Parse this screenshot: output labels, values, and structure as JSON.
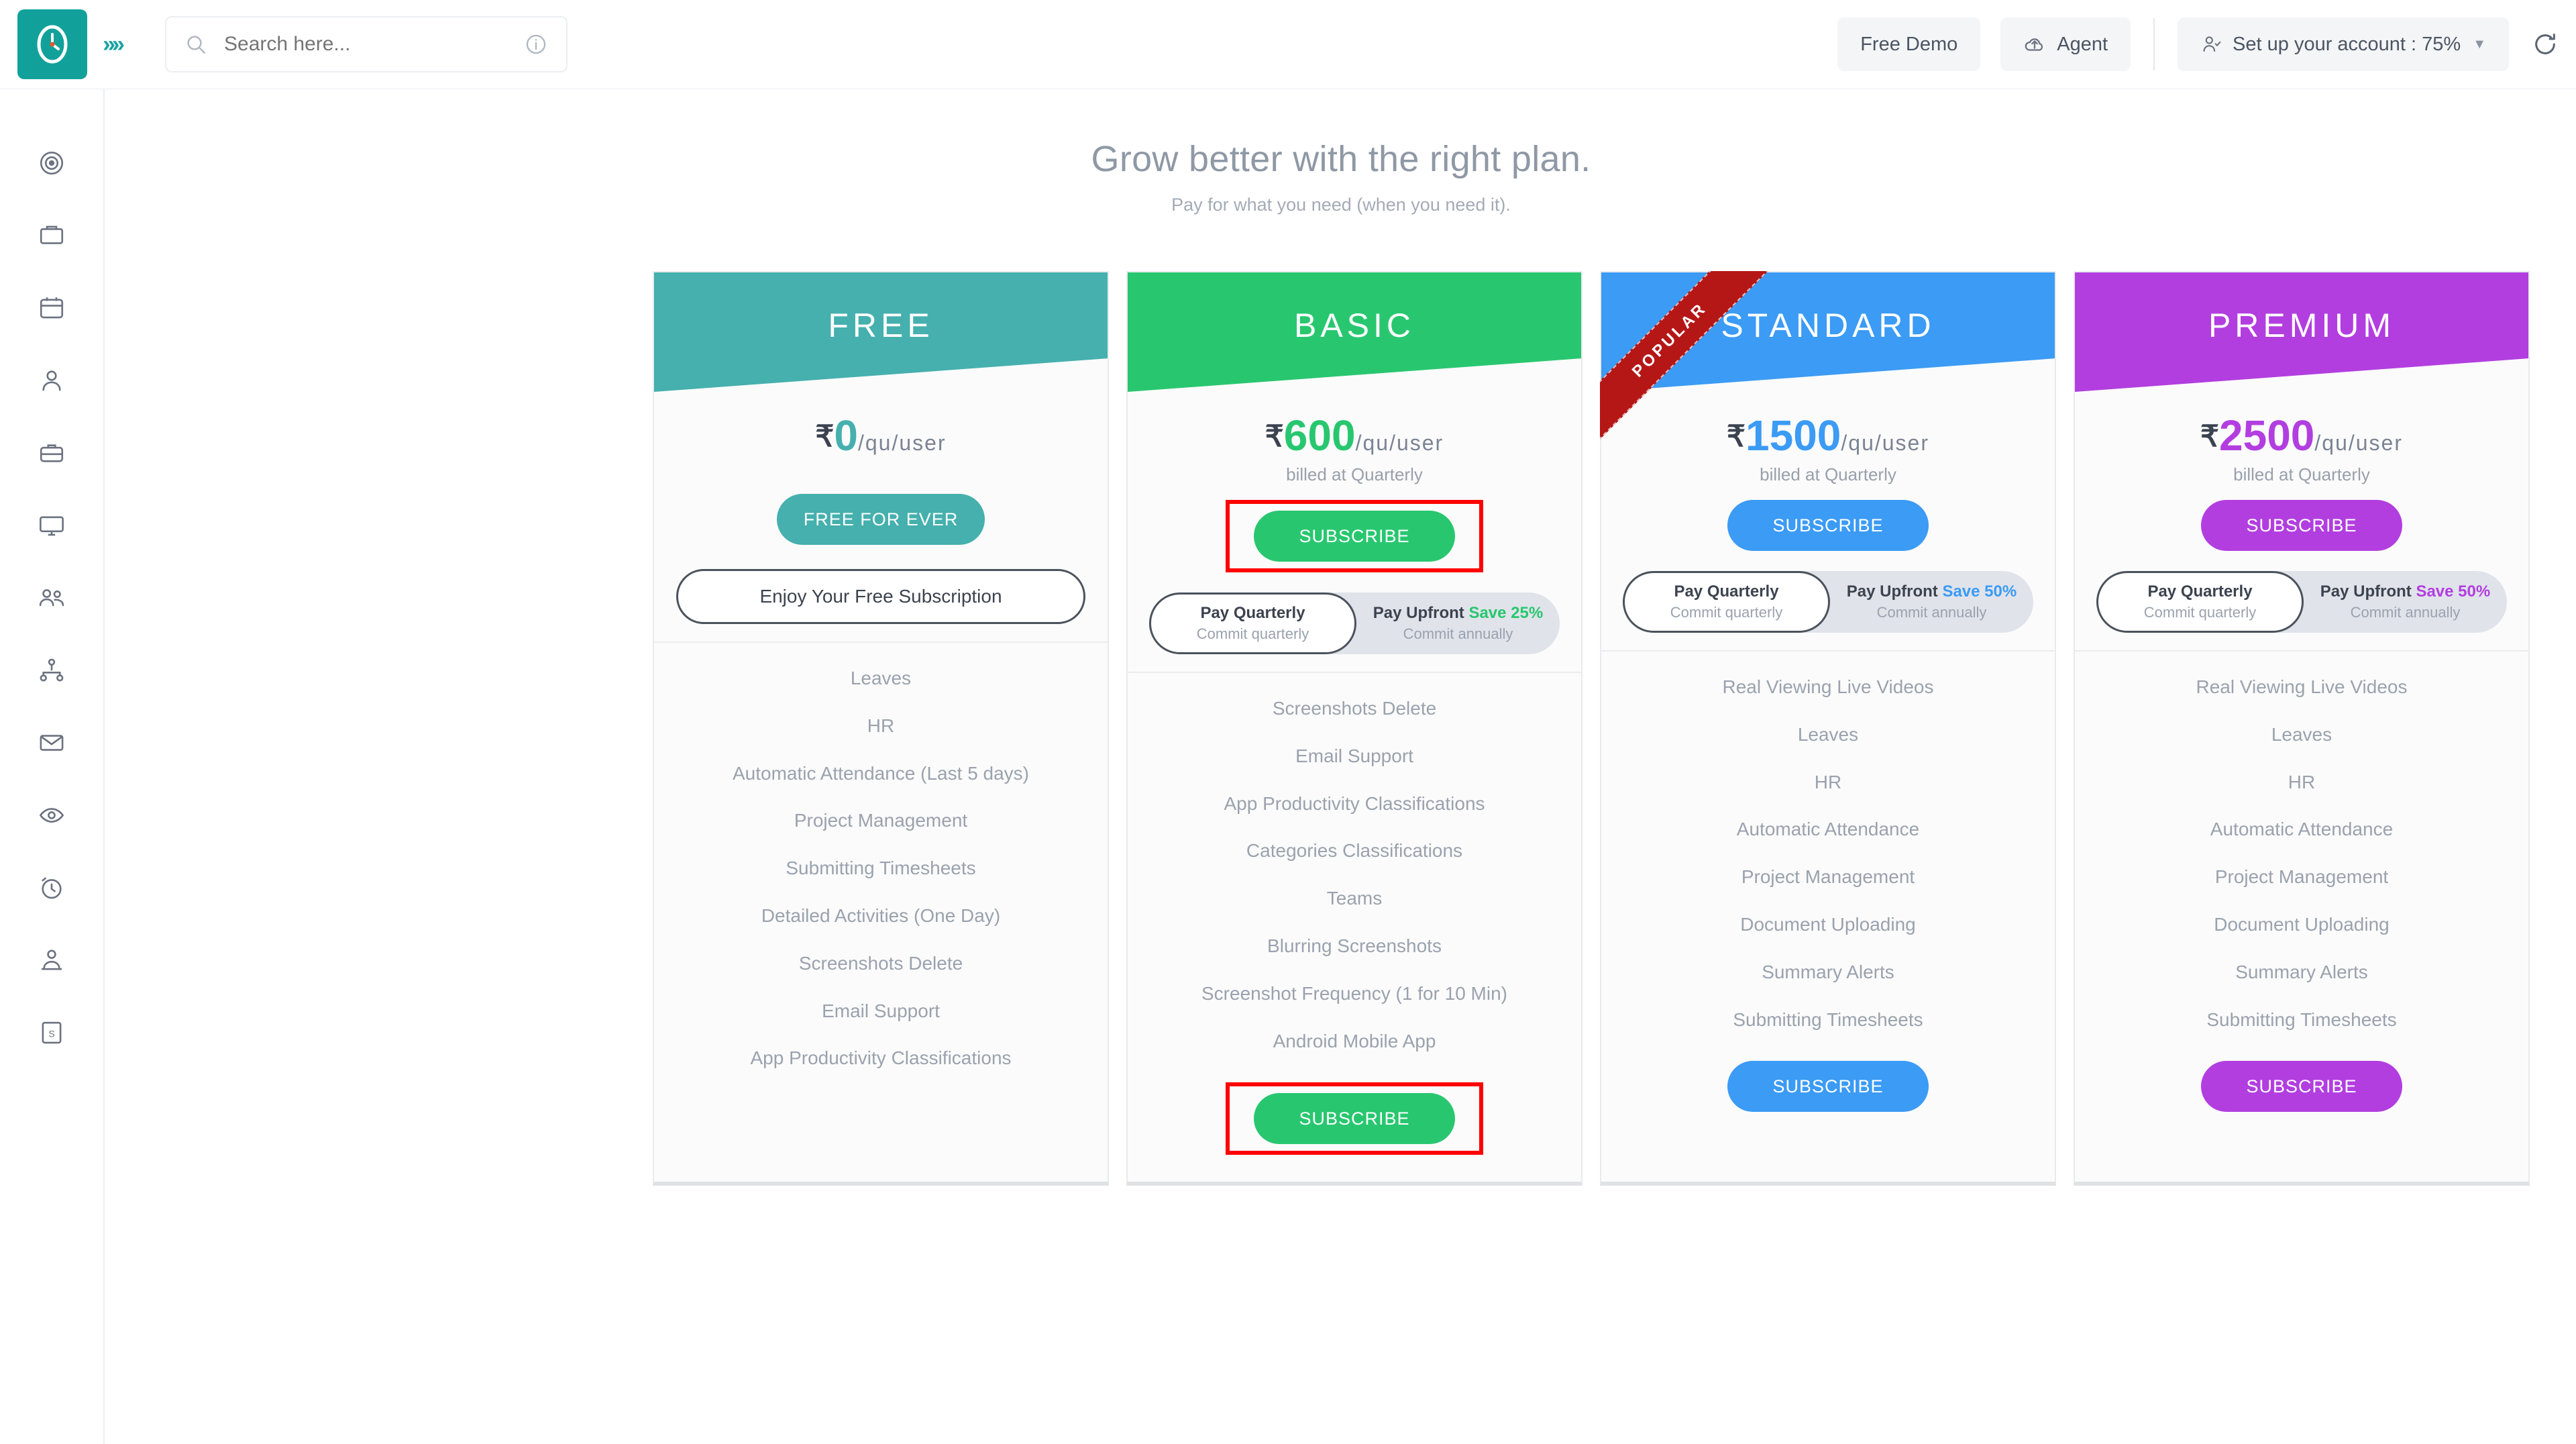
{
  "header": {
    "logo_icon": "clock-logo-icon",
    "expand_icon": "chevrons-right-icon",
    "search": {
      "placeholder": "Search here...",
      "value": "",
      "icon": "search-icon",
      "info_icon": "info-circle-icon"
    },
    "free_demo_label": "Free Demo",
    "agent_label": "Agent",
    "agent_icon": "cloud-upload-icon",
    "account_setup_label": "Set up your account : 75%",
    "account_icon": "user-check-icon",
    "caret_icon": "chevron-down-icon",
    "refresh_icon": "refresh-icon"
  },
  "sidebar": {
    "items": [
      {
        "icon": "dashboard-target-icon",
        "name": "sidebar-item-dashboard"
      },
      {
        "icon": "inbox-tray-icon",
        "name": "sidebar-item-inbox"
      },
      {
        "icon": "calendar-icon",
        "name": "sidebar-item-calendar"
      },
      {
        "icon": "user-icon",
        "name": "sidebar-item-user"
      },
      {
        "icon": "briefcase-icon",
        "name": "sidebar-item-briefcase"
      },
      {
        "icon": "monitor-icon",
        "name": "sidebar-item-monitor"
      },
      {
        "icon": "users-group-icon",
        "name": "sidebar-item-teams"
      },
      {
        "icon": "org-chart-icon",
        "name": "sidebar-item-org-chart"
      },
      {
        "icon": "envelope-icon",
        "name": "sidebar-item-mail"
      },
      {
        "icon": "eye-settings-icon",
        "name": "sidebar-item-monitoring"
      },
      {
        "icon": "timer-clock-icon",
        "name": "sidebar-item-timer"
      },
      {
        "icon": "user-network-icon",
        "name": "sidebar-item-members"
      },
      {
        "icon": "report-file-icon",
        "name": "sidebar-item-reports"
      }
    ]
  },
  "main": {
    "title": "Grow better with the right plan.",
    "subtitle": "Pay for what you need (when you need it).",
    "toggle_labels": {
      "left_top": "Pay Quarterly",
      "left_bottom": "Commit quarterly",
      "right_top": "Pay Upfront",
      "right_bottom": "Commit annually"
    },
    "plans": [
      {
        "name": "FREE",
        "accent": "#45b0ae",
        "currency": "₹",
        "amount": "0",
        "period": "/qu/user",
        "billed": "",
        "cta_label": "FREE FOR EVER",
        "cta_highlighted": false,
        "popular": false,
        "has_toggle": false,
        "enjoy_label": "Enjoy Your Free Subscription",
        "save_label": "",
        "features": [
          "Leaves",
          "HR",
          "Automatic Attendance (Last 5 days)",
          "Project Management",
          "Submitting Timesheets",
          "Detailed Activities (One Day)",
          "Screenshots Delete",
          "Email Support",
          "App Productivity Classifications"
        ],
        "footer_cta": ""
      },
      {
        "name": "BASIC",
        "accent": "#28c76f",
        "currency": "₹",
        "amount": "600",
        "period": "/qu/user",
        "billed": "billed at Quarterly",
        "cta_label": "SUBSCRIBE",
        "cta_highlighted": true,
        "popular": false,
        "has_toggle": true,
        "enjoy_label": "",
        "save_label": "Save 25%",
        "features": [
          "Screenshots Delete",
          "Email Support",
          "App Productivity Classifications",
          "Categories Classifications",
          "Teams",
          "Blurring Screenshots",
          "Screenshot Frequency (1 for 10 Min)",
          "Android Mobile App"
        ],
        "footer_cta": "SUBSCRIBE",
        "footer_highlighted": true
      },
      {
        "name": "STANDARD",
        "accent": "#3b9bf5",
        "currency": "₹",
        "amount": "1500",
        "period": "/qu/user",
        "billed": "billed at Quarterly",
        "cta_label": "SUBSCRIBE",
        "cta_highlighted": false,
        "popular": true,
        "popular_label": "POPULAR",
        "has_toggle": true,
        "enjoy_label": "",
        "save_label": "Save 50%",
        "features": [
          "Real Viewing Live Videos",
          "Leaves",
          "HR",
          "Automatic Attendance",
          "Project Management",
          "Document Uploading",
          "Summary Alerts",
          "Submitting Timesheets"
        ],
        "footer_cta": "SUBSCRIBE",
        "footer_highlighted": false
      },
      {
        "name": "PREMIUM",
        "accent": "#b23ee0",
        "currency": "₹",
        "amount": "2500",
        "period": "/qu/user",
        "billed": "billed at Quarterly",
        "cta_label": "SUBSCRIBE",
        "cta_highlighted": false,
        "popular": false,
        "has_toggle": true,
        "enjoy_label": "",
        "save_label": "Save 50%",
        "features": [
          "Real Viewing Live Videos",
          "Leaves",
          "HR",
          "Automatic Attendance",
          "Project Management",
          "Document Uploading",
          "Summary Alerts",
          "Submitting Timesheets"
        ],
        "footer_cta": "SUBSCRIBE",
        "footer_highlighted": false
      }
    ]
  }
}
